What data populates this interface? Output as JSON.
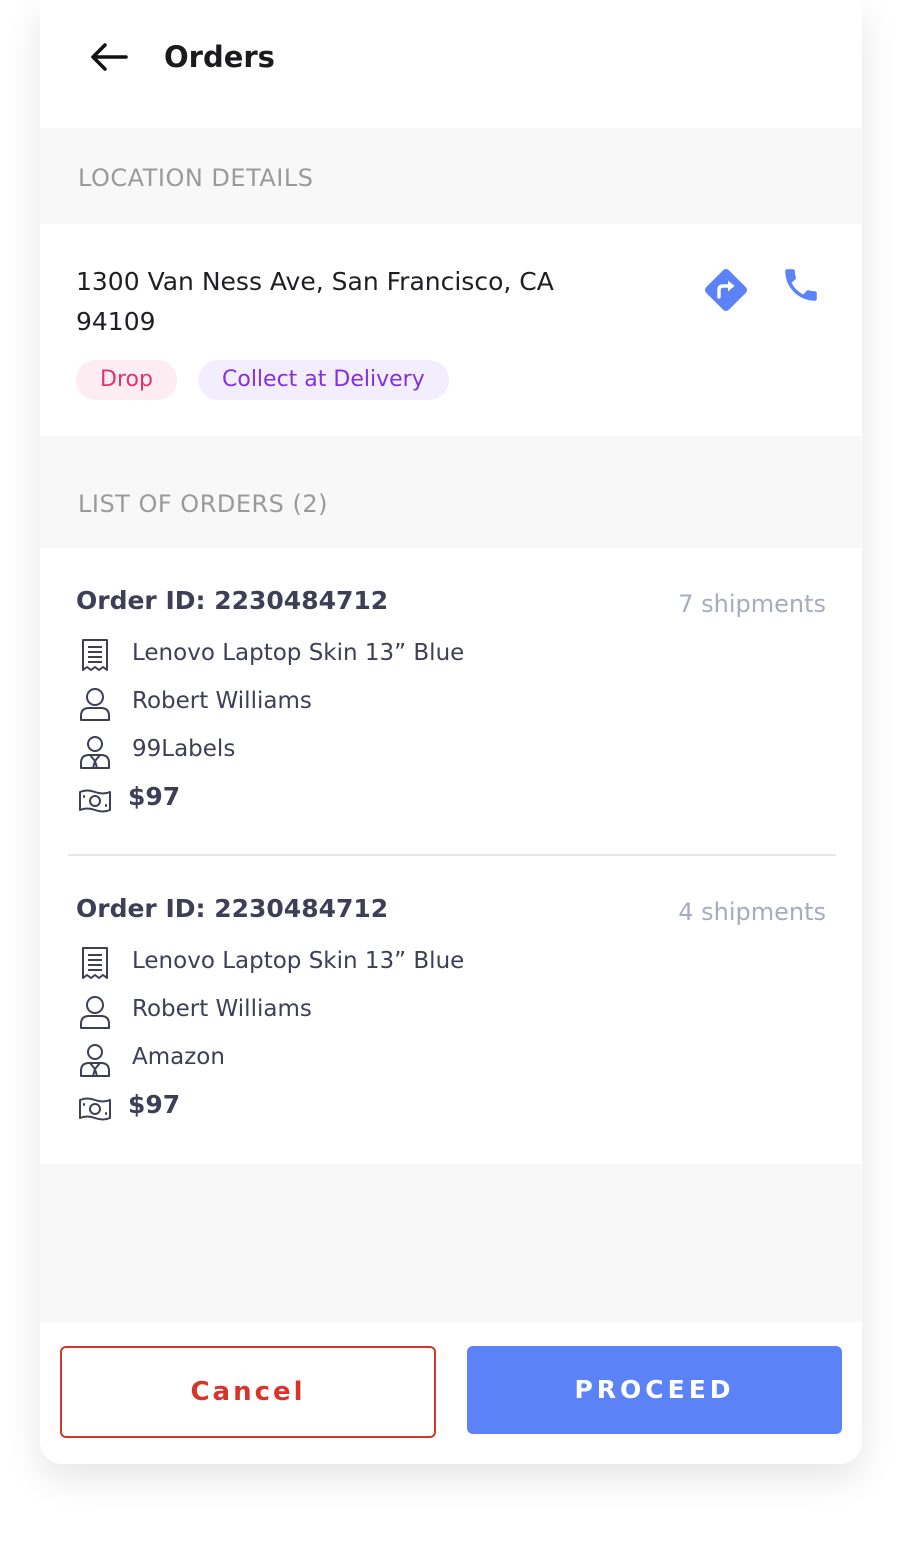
{
  "header": {
    "title": "Orders",
    "back_icon": "arrow-left-icon"
  },
  "location": {
    "section_label": "LOCATION DETAILS",
    "address": "1300 Van Ness Ave, San Francisco, CA 94109",
    "directions_icon": "directions-icon",
    "phone_icon": "phone-icon",
    "tags": [
      {
        "label": "Drop",
        "color": "#e0336f",
        "background": "#fdecf2"
      },
      {
        "label": "Collect at Delivery",
        "color": "#8430e0",
        "background": "#f3eefe"
      }
    ]
  },
  "orders": {
    "section_label": "LIST OF ORDERS (2)",
    "items": [
      {
        "order_id": "Order ID: 2230484712",
        "shipments": "7 shipments",
        "product": "Lenovo Laptop Skin 13” Blue",
        "customer": "Robert Williams",
        "seller": "99Labels",
        "amount": "$97"
      },
      {
        "order_id": "Order ID: 2230484712",
        "shipments": "4 shipments",
        "product": "Lenovo Laptop Skin 13” Blue",
        "customer": "Robert Williams",
        "seller": "Amazon",
        "amount": "$97"
      }
    ]
  },
  "footer": {
    "cancel_label": "Cancel",
    "proceed_label": "PROCEED"
  },
  "colors": {
    "accent": "#5b82f7",
    "danger": "#d8352a",
    "text": "#3c3f55",
    "muted": "#a7acbc"
  }
}
